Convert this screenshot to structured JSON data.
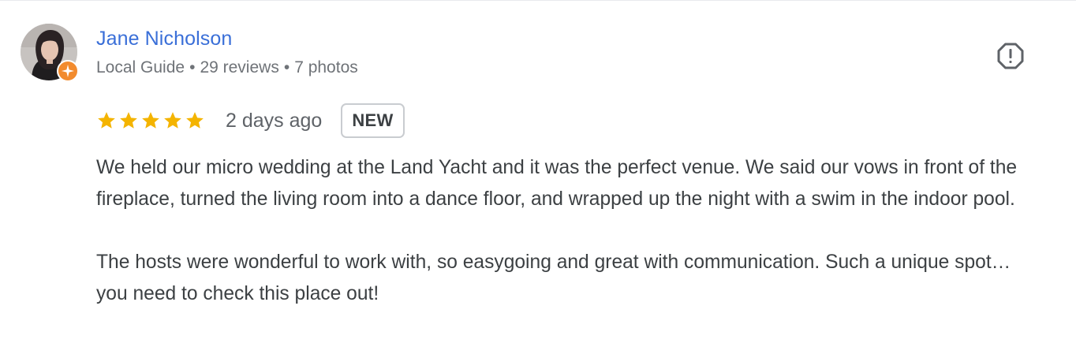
{
  "review": {
    "author": {
      "name": "Jane Nicholson",
      "role": "Local Guide",
      "reviews": "29 reviews",
      "photos": "7 photos",
      "separator": "•"
    },
    "date": "2 days ago",
    "badge": "NEW",
    "rating": 5,
    "max_rating": 5,
    "paragraphs": [
      "We held our micro wedding at the Land Yacht and it was the perfect venue. We said our vows in front of the fireplace, turned the living room into a dance floor, and wrapped up the night with a swim in the indoor pool.",
      "The hosts were wonderful to work with, so easygoing and great with communication. Such a unique spot… you need to check this place out!"
    ]
  },
  "icons": {
    "report": "report-flag-icon",
    "star": "star-icon",
    "guide_badge": "local-guide-badge-icon"
  },
  "colors": {
    "author_link": "#3a6fd8",
    "star": "#f4b400",
    "guide_badge": "#f28b2e",
    "meta_text": "#6f7378",
    "body_text": "#3c4043"
  }
}
